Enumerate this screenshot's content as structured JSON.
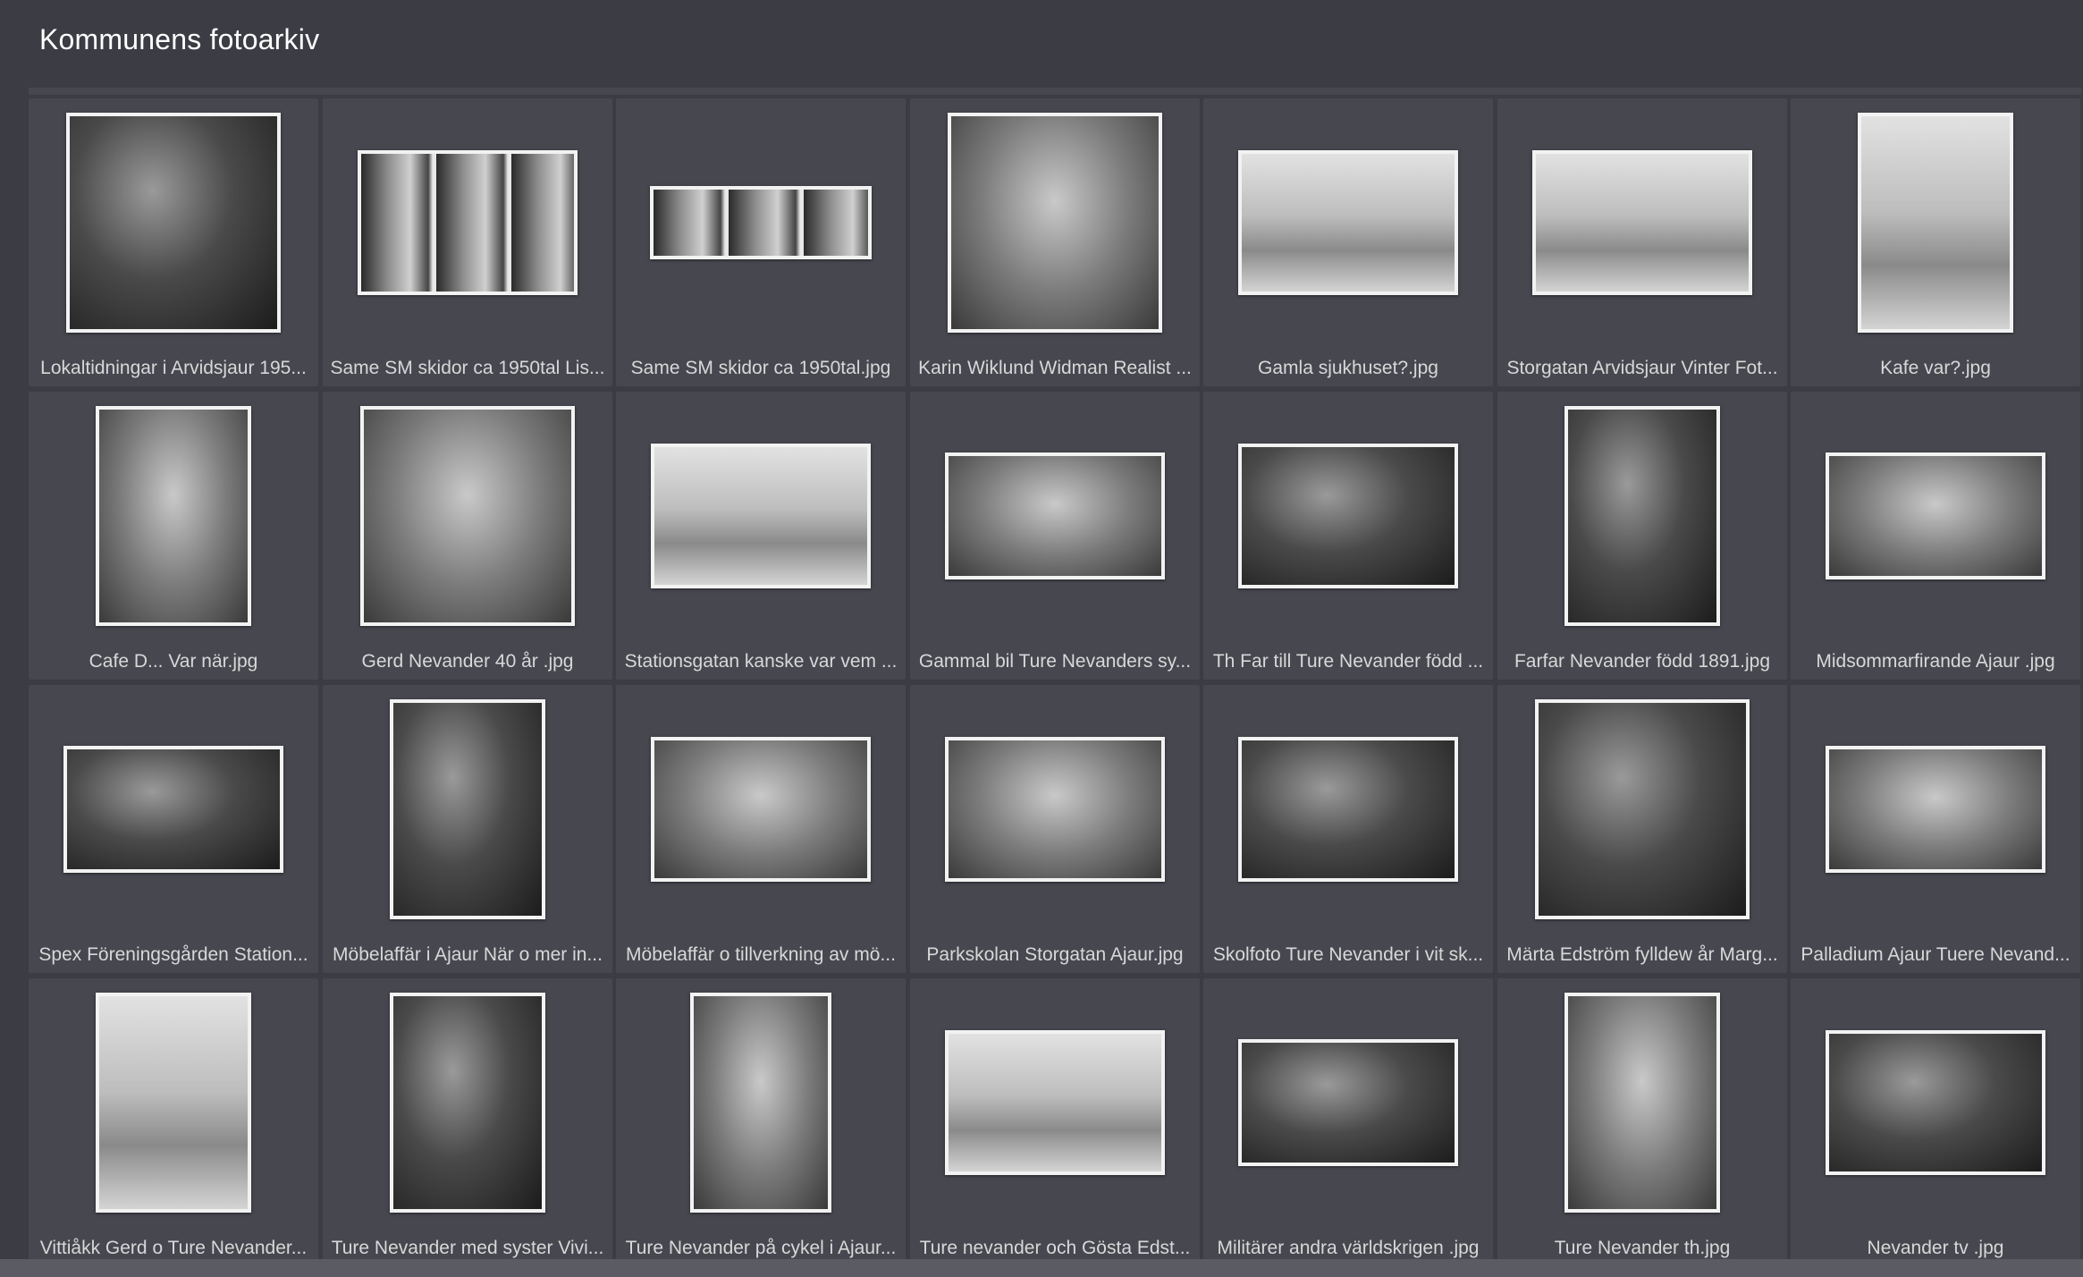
{
  "app": {
    "title": "Kommunens fotoarkiv"
  },
  "photos": [
    {
      "caption": "Lokaltidningar i Arvidsjaur 195...",
      "shape": "portrait-sq",
      "tone": "dark"
    },
    {
      "caption": "Same SM skidor ca 1950tal Lis...",
      "shape": "landscape",
      "tone": "collage"
    },
    {
      "caption": "Same SM skidor ca 1950tal.jpg",
      "shape": "panorama",
      "tone": "collage"
    },
    {
      "caption": "Karin Wiklund Widman Realist ...",
      "shape": "portrait-sq",
      "tone": "mid"
    },
    {
      "caption": "Gamla sjukhuset?.jpg",
      "shape": "landscape",
      "tone": "light"
    },
    {
      "caption": "Storgatan Arvidsjaur Vinter Fot...",
      "shape": "landscape",
      "tone": "light"
    },
    {
      "caption": "Kafe var?.jpg",
      "shape": "portrait",
      "tone": "light"
    },
    {
      "caption": "Cafe D... Var när.jpg",
      "shape": "portrait",
      "tone": "mid"
    },
    {
      "caption": "Gerd Nevander 40 år .jpg",
      "shape": "portrait-sq",
      "tone": "mid"
    },
    {
      "caption": "Stationsgatan kanske var vem ...",
      "shape": "landscape",
      "tone": "light"
    },
    {
      "caption": "Gammal bil Ture Nevanders sy...",
      "shape": "landscape-wide",
      "tone": "mid"
    },
    {
      "caption": "Th Far till Ture Nevander född ...",
      "shape": "landscape",
      "tone": "dark"
    },
    {
      "caption": "Farfar Nevander född 1891.jpg",
      "shape": "portrait",
      "tone": "dark"
    },
    {
      "caption": "Midsommarfirande Ajaur .jpg",
      "shape": "landscape-wide",
      "tone": "mid"
    },
    {
      "caption": "Spex Föreningsgården Station...",
      "shape": "landscape-wide",
      "tone": "dark"
    },
    {
      "caption": "Möbelaffär i Ajaur När o mer in...",
      "shape": "portrait",
      "tone": "dark"
    },
    {
      "caption": "Möbelaffär o tillverkning av mö...",
      "shape": "landscape",
      "tone": "mid"
    },
    {
      "caption": "Parkskolan Storgatan Ajaur.jpg",
      "shape": "landscape",
      "tone": "mid"
    },
    {
      "caption": "Skolfoto Ture Nevander i vit sk...",
      "shape": "landscape",
      "tone": "dark"
    },
    {
      "caption": "Märta Edström fylldew år Marg...",
      "shape": "portrait-sq",
      "tone": "dark"
    },
    {
      "caption": "Palladium Ajaur Tuere Nevand...",
      "shape": "landscape-wide",
      "tone": "mid"
    },
    {
      "caption": "Vittiåkk Gerd o Ture Nevander...",
      "shape": "portrait",
      "tone": "light"
    },
    {
      "caption": "Ture Nevander med syster Vivi...",
      "shape": "portrait",
      "tone": "dark"
    },
    {
      "caption": "Ture Nevander på cykel i Ajaur...",
      "shape": "portrait-tall",
      "tone": "mid"
    },
    {
      "caption": "Ture nevander och Gösta Edst...",
      "shape": "landscape",
      "tone": "light"
    },
    {
      "caption": "Militärer andra världskrigen .jpg",
      "shape": "landscape-wide",
      "tone": "dark"
    },
    {
      "caption": "Ture Nevander th.jpg",
      "shape": "portrait",
      "tone": "mid"
    },
    {
      "caption": "Nevander tv .jpg",
      "shape": "landscape",
      "tone": "dark"
    }
  ]
}
